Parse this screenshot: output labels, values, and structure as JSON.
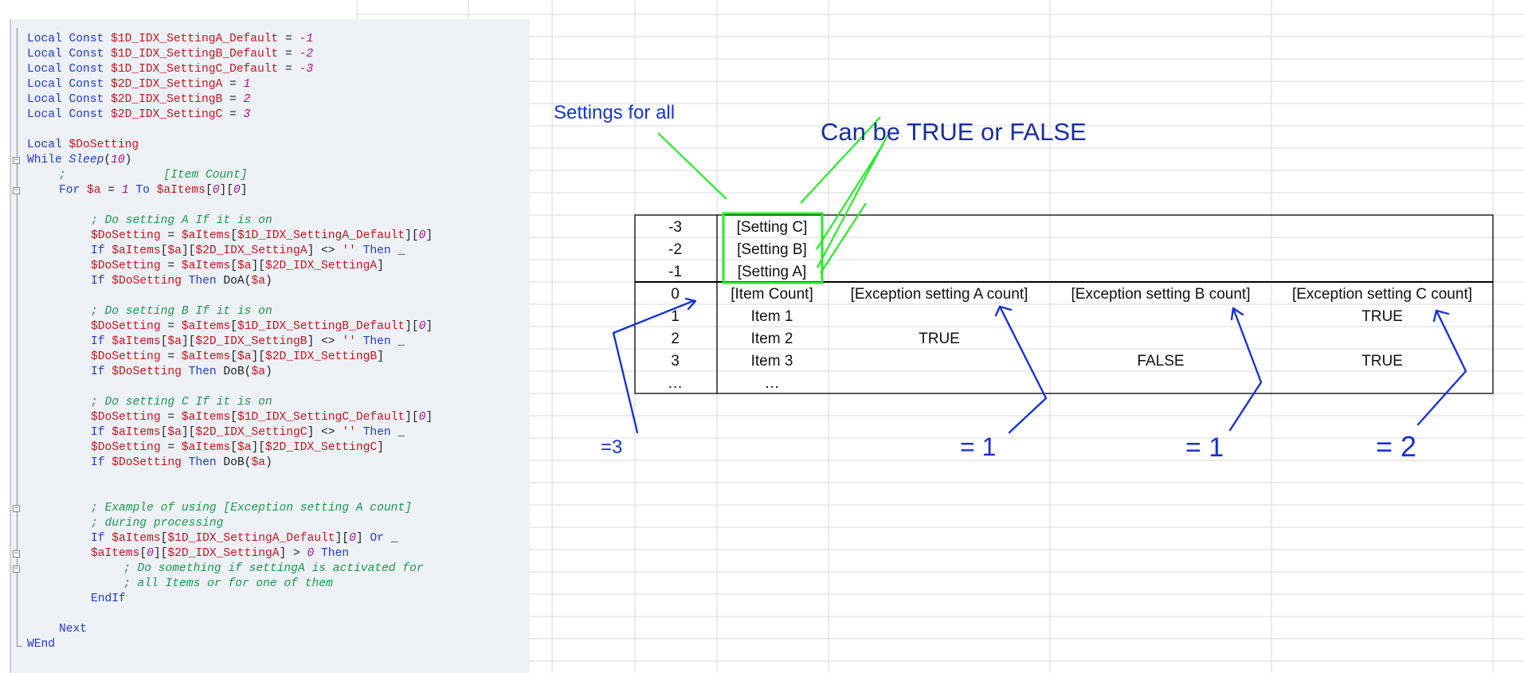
{
  "code": {
    "lines": [
      {
        "indent": 0,
        "tokens": [
          [
            "kw",
            "Local Const "
          ],
          [
            "var",
            "$1D_IDX_SettingA_Default"
          ],
          [
            "plain",
            " = "
          ],
          [
            "num",
            "-1"
          ]
        ]
      },
      {
        "indent": 0,
        "tokens": [
          [
            "kw",
            "Local Const "
          ],
          [
            "var",
            "$1D_IDX_SettingB_Default"
          ],
          [
            "plain",
            " = "
          ],
          [
            "num",
            "-2"
          ]
        ]
      },
      {
        "indent": 0,
        "tokens": [
          [
            "kw",
            "Local Const "
          ],
          [
            "var",
            "$1D_IDX_SettingC_Default"
          ],
          [
            "plain",
            " = "
          ],
          [
            "num",
            "-3"
          ]
        ]
      },
      {
        "indent": 0,
        "tokens": [
          [
            "kw",
            "Local Const "
          ],
          [
            "var",
            "$2D_IDX_SettingA"
          ],
          [
            "plain",
            " = "
          ],
          [
            "num",
            "1"
          ]
        ]
      },
      {
        "indent": 0,
        "tokens": [
          [
            "kw",
            "Local Const "
          ],
          [
            "var",
            "$2D_IDX_SettingB"
          ],
          [
            "plain",
            " = "
          ],
          [
            "num",
            "2"
          ]
        ]
      },
      {
        "indent": 0,
        "tokens": [
          [
            "kw",
            "Local Const "
          ],
          [
            "var",
            "$2D_IDX_SettingC"
          ],
          [
            "plain",
            " = "
          ],
          [
            "num",
            "3"
          ]
        ]
      },
      {
        "indent": 0,
        "tokens": []
      },
      {
        "indent": 0,
        "tokens": [
          [
            "kw",
            "Local "
          ],
          [
            "var",
            "$DoSetting"
          ]
        ]
      },
      {
        "indent": 0,
        "tokens": [
          [
            "kw",
            "While "
          ],
          [
            "fn",
            "Sleep"
          ],
          [
            "plain",
            "("
          ],
          [
            "num",
            "10"
          ],
          [
            "plain",
            ")"
          ]
        ]
      },
      {
        "indent": 1,
        "tokens": [
          [
            "cmt",
            ";              [Item Count]"
          ]
        ]
      },
      {
        "indent": 1,
        "tokens": [
          [
            "kw",
            "For "
          ],
          [
            "var",
            "$a"
          ],
          [
            "plain",
            " = "
          ],
          [
            "num",
            "1"
          ],
          [
            "kw",
            " To "
          ],
          [
            "var",
            "$aItems"
          ],
          [
            "plain",
            "["
          ],
          [
            "num",
            "0"
          ],
          [
            "plain",
            "]["
          ],
          [
            "num",
            "0"
          ],
          [
            "plain",
            "]"
          ]
        ]
      },
      {
        "indent": 2,
        "tokens": []
      },
      {
        "indent": 2,
        "tokens": [
          [
            "cmt",
            "; Do setting A If it is on"
          ]
        ]
      },
      {
        "indent": 2,
        "tokens": [
          [
            "var",
            "$DoSetting"
          ],
          [
            "plain",
            " = "
          ],
          [
            "var",
            "$aItems"
          ],
          [
            "plain",
            "["
          ],
          [
            "var",
            "$1D_IDX_SettingA_Default"
          ],
          [
            "plain",
            "]["
          ],
          [
            "num",
            "0"
          ],
          [
            "plain",
            "]"
          ]
        ]
      },
      {
        "indent": 2,
        "tokens": [
          [
            "kw",
            "If "
          ],
          [
            "var",
            "$aItems"
          ],
          [
            "plain",
            "["
          ],
          [
            "var",
            "$a"
          ],
          [
            "plain",
            "]["
          ],
          [
            "var",
            "$2D_IDX_SettingA"
          ],
          [
            "plain",
            "] <> "
          ],
          [
            "str",
            "''"
          ],
          [
            "kw",
            " Then "
          ],
          [
            "plain",
            "_"
          ]
        ]
      },
      {
        "indent": 2,
        "tokens": [
          [
            "var",
            "$DoSetting"
          ],
          [
            "plain",
            " = "
          ],
          [
            "var",
            "$aItems"
          ],
          [
            "plain",
            "["
          ],
          [
            "var",
            "$a"
          ],
          [
            "plain",
            "]["
          ],
          [
            "var",
            "$2D_IDX_SettingA"
          ],
          [
            "plain",
            "]"
          ]
        ]
      },
      {
        "indent": 2,
        "tokens": [
          [
            "kw",
            "If "
          ],
          [
            "var",
            "$DoSetting"
          ],
          [
            "kw",
            " Then "
          ],
          [
            "plain",
            "DoA("
          ],
          [
            "var",
            "$a"
          ],
          [
            "plain",
            ")"
          ]
        ]
      },
      {
        "indent": 2,
        "tokens": []
      },
      {
        "indent": 2,
        "tokens": [
          [
            "cmt",
            "; Do setting B If it is on"
          ]
        ]
      },
      {
        "indent": 2,
        "tokens": [
          [
            "var",
            "$DoSetting"
          ],
          [
            "plain",
            " = "
          ],
          [
            "var",
            "$aItems"
          ],
          [
            "plain",
            "["
          ],
          [
            "var",
            "$1D_IDX_SettingB_Default"
          ],
          [
            "plain",
            "]["
          ],
          [
            "num",
            "0"
          ],
          [
            "plain",
            "]"
          ]
        ]
      },
      {
        "indent": 2,
        "tokens": [
          [
            "kw",
            "If "
          ],
          [
            "var",
            "$aItems"
          ],
          [
            "plain",
            "["
          ],
          [
            "var",
            "$a"
          ],
          [
            "plain",
            "]["
          ],
          [
            "var",
            "$2D_IDX_SettingB"
          ],
          [
            "plain",
            "] <> "
          ],
          [
            "str",
            "''"
          ],
          [
            "kw",
            " Then "
          ],
          [
            "plain",
            "_"
          ]
        ]
      },
      {
        "indent": 2,
        "tokens": [
          [
            "var",
            "$DoSetting"
          ],
          [
            "plain",
            " = "
          ],
          [
            "var",
            "$aItems"
          ],
          [
            "plain",
            "["
          ],
          [
            "var",
            "$a"
          ],
          [
            "plain",
            "]["
          ],
          [
            "var",
            "$2D_IDX_SettingB"
          ],
          [
            "plain",
            "]"
          ]
        ]
      },
      {
        "indent": 2,
        "tokens": [
          [
            "kw",
            "If "
          ],
          [
            "var",
            "$DoSetting"
          ],
          [
            "kw",
            " Then "
          ],
          [
            "plain",
            "DoB("
          ],
          [
            "var",
            "$a"
          ],
          [
            "plain",
            ")"
          ]
        ]
      },
      {
        "indent": 2,
        "tokens": []
      },
      {
        "indent": 2,
        "tokens": [
          [
            "cmt",
            "; Do setting C If it is on"
          ]
        ]
      },
      {
        "indent": 2,
        "tokens": [
          [
            "var",
            "$DoSetting"
          ],
          [
            "plain",
            " = "
          ],
          [
            "var",
            "$aItems"
          ],
          [
            "plain",
            "["
          ],
          [
            "var",
            "$1D_IDX_SettingC_Default"
          ],
          [
            "plain",
            "]["
          ],
          [
            "num",
            "0"
          ],
          [
            "plain",
            "]"
          ]
        ]
      },
      {
        "indent": 2,
        "tokens": [
          [
            "kw",
            "If "
          ],
          [
            "var",
            "$aItems"
          ],
          [
            "plain",
            "["
          ],
          [
            "var",
            "$a"
          ],
          [
            "plain",
            "]["
          ],
          [
            "var",
            "$2D_IDX_SettingC"
          ],
          [
            "plain",
            "] <> "
          ],
          [
            "str",
            "''"
          ],
          [
            "kw",
            " Then "
          ],
          [
            "plain",
            "_"
          ]
        ]
      },
      {
        "indent": 2,
        "tokens": [
          [
            "var",
            "$DoSetting"
          ],
          [
            "plain",
            " = "
          ],
          [
            "var",
            "$aItems"
          ],
          [
            "plain",
            "["
          ],
          [
            "var",
            "$a"
          ],
          [
            "plain",
            "]["
          ],
          [
            "var",
            "$2D_IDX_SettingC"
          ],
          [
            "plain",
            "]"
          ]
        ]
      },
      {
        "indent": 2,
        "tokens": [
          [
            "kw",
            "If "
          ],
          [
            "var",
            "$DoSetting"
          ],
          [
            "kw",
            " Then "
          ],
          [
            "plain",
            "DoB("
          ],
          [
            "var",
            "$a"
          ],
          [
            "plain",
            ")"
          ]
        ]
      },
      {
        "indent": 2,
        "tokens": []
      },
      {
        "indent": 2,
        "tokens": []
      },
      {
        "indent": 2,
        "tokens": [
          [
            "cmt",
            "; Example of using [Exception setting A count]"
          ]
        ]
      },
      {
        "indent": 2,
        "tokens": [
          [
            "cmt",
            "; during processing"
          ]
        ]
      },
      {
        "indent": 2,
        "tokens": [
          [
            "kw",
            "If "
          ],
          [
            "var",
            "$aItems"
          ],
          [
            "plain",
            "["
          ],
          [
            "var",
            "$1D_IDX_SettingA_Default"
          ],
          [
            "plain",
            "]["
          ],
          [
            "num",
            "0"
          ],
          [
            "plain",
            "]"
          ],
          [
            "kw",
            " Or "
          ],
          [
            "plain",
            "_"
          ]
        ]
      },
      {
        "indent": 2,
        "tokens": [
          [
            "var",
            "$aItems"
          ],
          [
            "plain",
            "["
          ],
          [
            "num",
            "0"
          ],
          [
            "plain",
            "]["
          ],
          [
            "var",
            "$2D_IDX_SettingA"
          ],
          [
            "plain",
            "] > "
          ],
          [
            "num",
            "0"
          ],
          [
            "kw",
            " Then"
          ]
        ]
      },
      {
        "indent": 3,
        "tokens": [
          [
            "cmt",
            "; Do something if settingA is activated for"
          ]
        ]
      },
      {
        "indent": 3,
        "tokens": [
          [
            "cmt",
            "; all Items or for one of them"
          ]
        ]
      },
      {
        "indent": 2,
        "tokens": [
          [
            "kw",
            "EndIf"
          ]
        ]
      },
      {
        "indent": 2,
        "tokens": []
      },
      {
        "indent": 1,
        "tokens": [
          [
            "kw",
            "Next"
          ]
        ]
      },
      {
        "indent": 0,
        "tokens": [
          [
            "kw",
            "WEnd"
          ]
        ]
      }
    ]
  },
  "annotations": {
    "settings_for_all": "Settings for all",
    "can_be_true_false": "Can be TRUE or FALSE",
    "eq_item_count": "=3",
    "eq_setting_a": "= 1",
    "eq_setting_b": "= 1",
    "eq_setting_c": "= 2"
  },
  "table": {
    "default_rows": [
      {
        "index": "-3",
        "label": "[Setting C]"
      },
      {
        "index": "-2",
        "label": "[Setting B]"
      },
      {
        "index": "-1",
        "label": "[Setting A]"
      }
    ],
    "header": {
      "index": "0",
      "item_count": "[Item Count]",
      "exc_a": "[Exception setting A count]",
      "exc_b": "[Exception setting B count]",
      "exc_c": "[Exception setting C count]"
    },
    "rows": [
      {
        "index": "1",
        "item": "Item 1",
        "a": "",
        "b": "",
        "c": "TRUE"
      },
      {
        "index": "2",
        "item": "Item 2",
        "a": "TRUE",
        "b": "",
        "c": ""
      },
      {
        "index": "3",
        "item": "Item 3",
        "a": "",
        "b": "FALSE",
        "c": "TRUE"
      },
      {
        "index": "…",
        "item": "…",
        "a": "",
        "b": "",
        "c": ""
      }
    ]
  },
  "colors": {
    "annotation_blue": "#1733d6",
    "arrow_green": "#22ee22",
    "title_blue": "#1a2ea0"
  }
}
